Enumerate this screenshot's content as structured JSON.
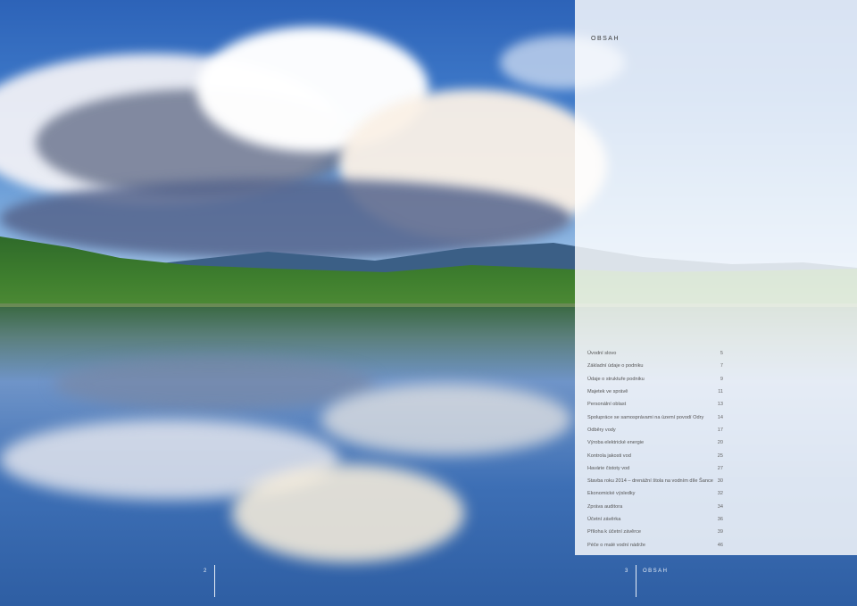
{
  "panel": {
    "title": "OBSAH"
  },
  "toc": [
    {
      "label": "Úvodní slovo",
      "page": "5"
    },
    {
      "label": "Základní údaje o podniku",
      "page": "7"
    },
    {
      "label": "Údaje o struktuře podniku",
      "page": "9"
    },
    {
      "label": "Majetek ve správě",
      "page": "11"
    },
    {
      "label": "Personální oblast",
      "page": "13"
    },
    {
      "label": "Spolupráce se samosprávami na území povodí Odry",
      "page": "14"
    },
    {
      "label": "Odběry vody",
      "page": "17"
    },
    {
      "label": "Výroba elektrické energie",
      "page": "20"
    },
    {
      "label": "Kontrola jakosti vod",
      "page": "25"
    },
    {
      "label": "Havárie čistoty vod",
      "page": "27"
    },
    {
      "label": "Stavba roku 2014 – drenážní štola na vodním díle Šance",
      "page": "30"
    },
    {
      "label": "Ekonomické výsledky",
      "page": "32"
    },
    {
      "label": "Zpráva auditora",
      "page": "34"
    },
    {
      "label": "Účetní závěrka",
      "page": "36"
    },
    {
      "label": "Příloha k účetní závěrce",
      "page": "39"
    },
    {
      "label": "Péče o malé vodní nádrže",
      "page": "46"
    }
  ],
  "footer": {
    "left_page": "2",
    "right_page": "3",
    "right_label": "OBSAH"
  }
}
